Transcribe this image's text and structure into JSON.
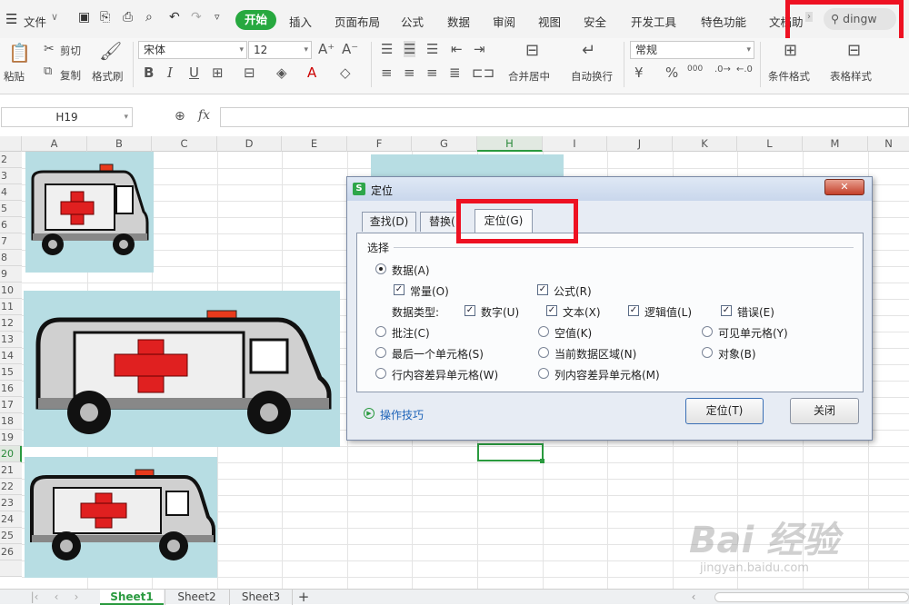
{
  "menu": {
    "file": "文件",
    "tabs": [
      "开始",
      "插入",
      "页面布局",
      "公式",
      "数据",
      "审阅",
      "视图",
      "安全",
      "开发工具",
      "特色功能",
      "文档助"
    ],
    "search": "dingw"
  },
  "ribbon": {
    "paste": "粘贴",
    "cut": "剪切",
    "copy": "复制",
    "format_painter": "格式刷",
    "font_name": "宋体",
    "font_size": "12",
    "merge": "合并居中",
    "wrap": "自动换行",
    "number_format": "常规",
    "cond_format": "条件格式",
    "table_style": "表格样式",
    "bold": "B",
    "italic": "I",
    "underline": "U",
    "percent": "%",
    "thousands": "000"
  },
  "formula_bar": {
    "name_box": "H19",
    "fx": "fx"
  },
  "columns": [
    "A",
    "B",
    "C",
    "D",
    "E",
    "F",
    "G",
    "H",
    "I",
    "J",
    "K",
    "L",
    "M",
    "N"
  ],
  "rows": [
    "2",
    "3",
    "4",
    "5",
    "6",
    "7",
    "8",
    "9",
    "10",
    "11",
    "12",
    "13",
    "14",
    "15",
    "16",
    "17",
    "18",
    "19",
    "20",
    "21",
    "22",
    "23",
    "24",
    "25",
    "26"
  ],
  "dialog": {
    "title": "定位",
    "close": "✕",
    "tab_find": "查找(D)",
    "tab_replace": "替换(",
    "tab_goto": "定位(G)",
    "section": "选择",
    "opt_data": "数据(A)",
    "chk_constant": "常量(O)",
    "chk_formula": "公式(R)",
    "data_type_label": "数据类型:",
    "chk_number": "数字(U)",
    "chk_text": "文本(X)",
    "chk_logic": "逻辑值(L)",
    "chk_error": "错误(E)",
    "opt_comment": "批注(C)",
    "opt_blank": "空值(K)",
    "opt_visible": "可见单元格(Y)",
    "opt_last_cell": "最后一个单元格(S)",
    "opt_current_region": "当前数据区域(N)",
    "opt_object": "对象(B)",
    "opt_row_diff": "行内容差异单元格(W)",
    "opt_col_diff": "列内容差异单元格(M)",
    "tips": "操作技巧",
    "btn_goto": "定位(T)",
    "btn_close": "关闭"
  },
  "sheets": [
    "Sheet1",
    "Sheet2",
    "Sheet3"
  ],
  "watermark": {
    "main": "Bai 经验",
    "sub": "jingyan.baidu.com"
  },
  "colors": {
    "accent_green": "#27a83f",
    "highlight_red": "#ee1122",
    "picture_bg": "#b7dde3"
  }
}
